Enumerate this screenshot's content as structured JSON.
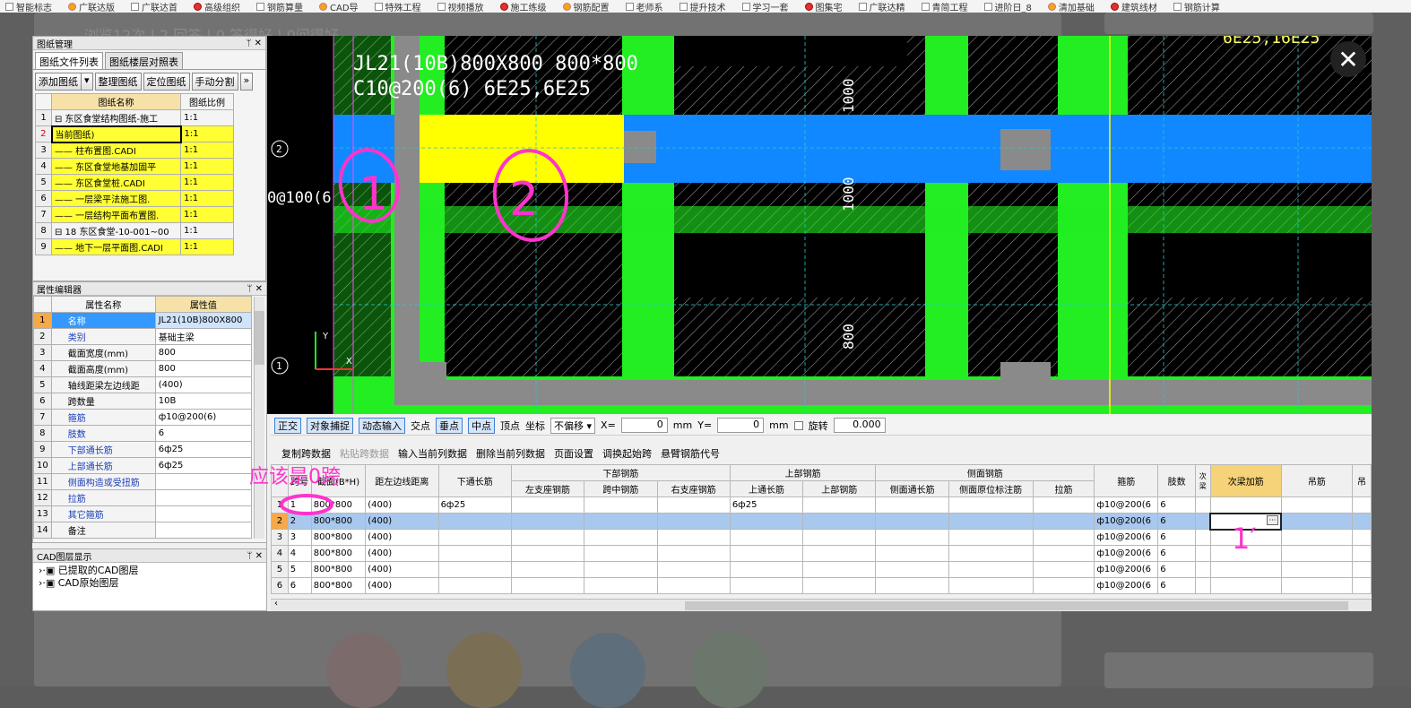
{
  "bookmarks": [
    "智能标志",
    "广联达版",
    "广联达首",
    "高级组织",
    "钢筋算量",
    "CAD导",
    "特殊工程",
    "视频播放",
    "施工练级",
    "钢筋配置",
    "老师系",
    "提升技术",
    "学习一套",
    "图集宅",
    "广联达精",
    "青简工程",
    "进阶日_8",
    "清加基础",
    "建筑线材",
    "钢筋计算"
  ],
  "page_hint": "浏览12次 | 2 回答 | 0 答得好 | 0问得好",
  "drawing_manager": {
    "title": "图纸管理",
    "pin": "ᛘ ✕",
    "tabs": [
      "图纸文件列表",
      "图纸楼层对照表"
    ],
    "buttons": [
      "添加图纸",
      "▾",
      "整理图纸",
      "定位图纸",
      "手动分割",
      "»"
    ],
    "headers": [
      "图纸名称",
      "图纸比例"
    ],
    "rows": [
      {
        "n": "1",
        "name": "⊟ 东区食堂结构图纸-施工",
        "scale": "1:1"
      },
      {
        "n": "2",
        "name": "当前图纸)",
        "scale": "1:1"
      },
      {
        "n": "3",
        "name": "—— 柱布置图.CADI",
        "scale": "1:1"
      },
      {
        "n": "4",
        "name": "—— 东区食堂地基加固平",
        "scale": "1:1"
      },
      {
        "n": "5",
        "name": "—— 东区食堂桩.CADI",
        "scale": "1:1"
      },
      {
        "n": "6",
        "name": "—— 一层梁平法施工图.",
        "scale": "1:1"
      },
      {
        "n": "7",
        "name": "—— 一层结构平面布置图.",
        "scale": "1:1"
      },
      {
        "n": "8",
        "name": "⊟ 18 东区食堂-10-001~00",
        "scale": "1:1"
      },
      {
        "n": "9",
        "name": "—— 地下一层平面图.CADI",
        "scale": "1:1"
      }
    ]
  },
  "property_editor": {
    "title": "属性编辑器",
    "pin": "ᛘ ✕",
    "headers": [
      "属性名称",
      "属性值"
    ],
    "rows": [
      {
        "n": "1",
        "name": "名称",
        "value": "JL21(10B)800X800"
      },
      {
        "n": "2",
        "name": "类别",
        "value": "基础主梁"
      },
      {
        "n": "3",
        "name": "截面宽度(mm)",
        "value": "800"
      },
      {
        "n": "4",
        "name": "截面高度(mm)",
        "value": "800"
      },
      {
        "n": "5",
        "name": "轴线距梁左边线距",
        "value": "(400)"
      },
      {
        "n": "6",
        "name": "跨数量",
        "value": "10B"
      },
      {
        "n": "7",
        "name": "箍筋",
        "value": "ф10@200(6)"
      },
      {
        "n": "8",
        "name": "肢数",
        "value": "6"
      },
      {
        "n": "9",
        "name": "下部通长筋",
        "value": "6ф25"
      },
      {
        "n": "10",
        "name": "上部通长筋",
        "value": "6ф25"
      },
      {
        "n": "11",
        "name": "侧面构造或受扭筋",
        "value": ""
      },
      {
        "n": "12",
        "name": "拉筋",
        "value": ""
      },
      {
        "n": "13",
        "name": "其它箍筋",
        "value": ""
      },
      {
        "n": "14",
        "name": "备注",
        "value": ""
      }
    ]
  },
  "cad_layers": {
    "title": "CAD图层显示",
    "pin": "ᛘ ✕",
    "items": [
      "›·▣ 已提取的CAD图层",
      "›·▣ CAD原始图层"
    ]
  },
  "cad": {
    "label_line1": "JL21(10B)800X800 800*800",
    "label_line2": "C10@200(6) 6E25,6E25",
    "left_text": "0@100(6",
    "top_right_text": "6E25,16E25",
    "dim_1000a": "1000",
    "dim_1000b": "1000",
    "dim_800": "800",
    "axis_2": "2",
    "axis_1": "1",
    "ucs_y": "Y",
    "ucs_x": "X"
  },
  "snapbar": {
    "items": [
      "正交",
      "对象捕捉",
      "动态输入",
      "交点",
      "垂点",
      "中点",
      "顶点",
      "坐标"
    ],
    "offset": "不偏移 ▾",
    "x_label": "X=",
    "x_value": "0",
    "mm1": "mm",
    "y_label": "Y=",
    "y_value": "0",
    "mm2": "mm",
    "rotate_label": "旋转",
    "rotate_value": "0.000"
  },
  "span_toolbar": [
    "复制跨数据",
    "粘贴跨数据",
    "输入当前列数据",
    "删除当前列数据",
    "页面设置",
    "调换起始跨",
    "悬臂钢筋代号"
  ],
  "span_table": {
    "groups": [
      "下部钢筋",
      "上部钢筋",
      "侧面钢筋"
    ],
    "headers": [
      "跨号",
      "截面(B*H)",
      "距左边线距离",
      "下通长筋",
      "左支座钢筋",
      "跨中钢筋",
      "右支座钢筋",
      "上通长筋",
      "上部钢筋",
      "侧面通长筋",
      "侧面原位标注筋",
      "拉筋",
      "箍筋",
      "肢数",
      "次梁",
      "次梁加筋",
      "吊筋",
      "吊"
    ],
    "rows": [
      {
        "n": "1",
        "span": "1",
        "sec": "800*800",
        "dist": "(400)",
        "bot": "6ф25",
        "top": "6ф25",
        "stir": "ф10@200(6",
        "legs": "6"
      },
      {
        "n": "2",
        "span": "2",
        "sec": "800*800",
        "dist": "(400)",
        "bot": "",
        "top": "",
        "stir": "ф10@200(6",
        "legs": "6"
      },
      {
        "n": "3",
        "span": "3",
        "sec": "800*800",
        "dist": "(400)",
        "bot": "",
        "top": "",
        "stir": "ф10@200(6",
        "legs": "6"
      },
      {
        "n": "4",
        "span": "4",
        "sec": "800*800",
        "dist": "(400)",
        "bot": "",
        "top": "",
        "stir": "ф10@200(6",
        "legs": "6"
      },
      {
        "n": "5",
        "span": "5",
        "sec": "800*800",
        "dist": "(400)",
        "bot": "",
        "top": "",
        "stir": "ф10@200(6",
        "legs": "6"
      },
      {
        "n": "6",
        "span": "6",
        "sec": "800*800",
        "dist": "(400)",
        "bot": "",
        "top": "",
        "stir": "ф10@200(6",
        "legs": "6"
      }
    ],
    "edit_button": "···"
  },
  "annotations": {
    "should_be": "应该是0跨",
    "mark_1": "1",
    "mark_2": "2",
    "mark_1prime": "1′"
  },
  "close_button": "✕",
  "colors": {
    "cad_green": "#22ee22",
    "cad_blue": "#1188ff",
    "cad_yellow": "#ffff00",
    "annot": "#ff33cc"
  }
}
